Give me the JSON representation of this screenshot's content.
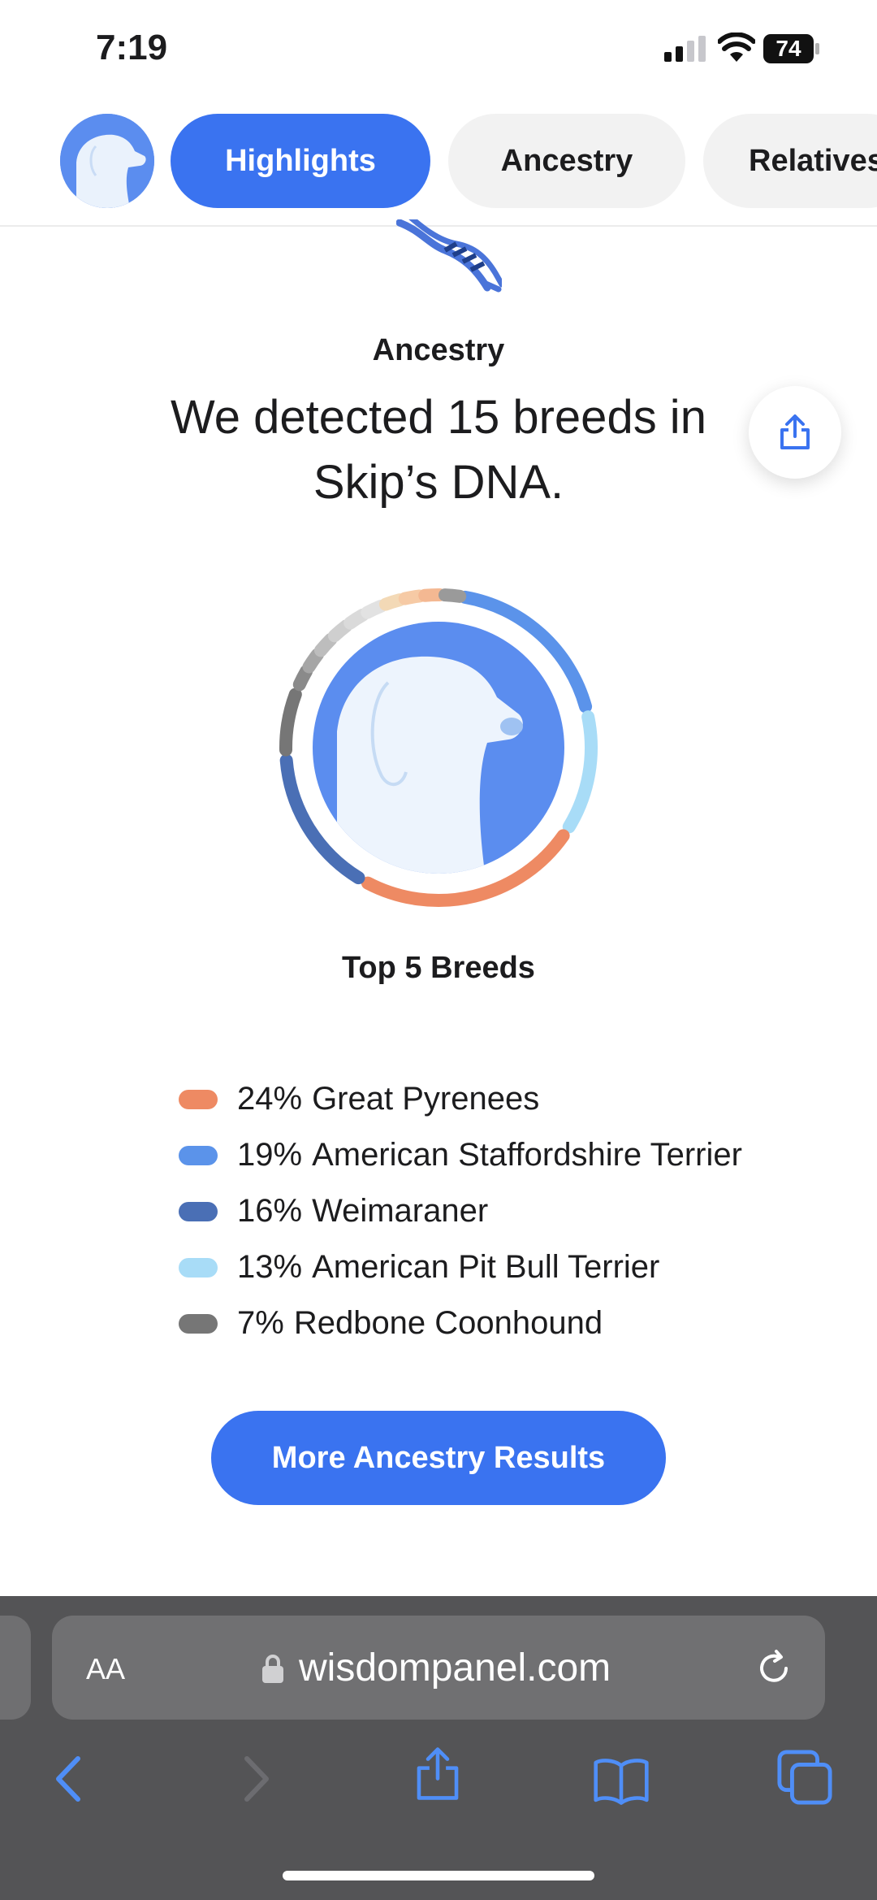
{
  "status_bar": {
    "time": "7:19",
    "battery": "74"
  },
  "tabs": [
    {
      "label": "Highlights",
      "active": true
    },
    {
      "label": "Ancestry",
      "active": false
    },
    {
      "label": "Relatives",
      "active": false
    }
  ],
  "hero": {
    "section_label": "Ancestry",
    "headline": "We detected 15 breeds in Skip’s DNA."
  },
  "chart_data": {
    "type": "pie",
    "title": "Top 5 Breeds",
    "breed_count": 15,
    "series": [
      {
        "name": "Great Pyrenees",
        "value": 24,
        "color": "#ee8a63"
      },
      {
        "name": "American Staffordshire Terrier",
        "value": 19,
        "color": "#5b93ea"
      },
      {
        "name": "Weimaraner",
        "value": 16,
        "color": "#4a6fb5"
      },
      {
        "name": "American Pit Bull Terrier",
        "value": 13,
        "color": "#a8dcf7"
      },
      {
        "name": "Redbone Coonhound",
        "value": 7,
        "color": "#767676"
      }
    ]
  },
  "legend": [
    {
      "pct": "24%",
      "name": "Great Pyrenees",
      "color": "#ee8a63"
    },
    {
      "pct": "19%",
      "name": "American Staffordshire Terrier",
      "color": "#5b93ea"
    },
    {
      "pct": "16%",
      "name": "Weimaraner",
      "color": "#4a6fb5"
    },
    {
      "pct": "13%",
      "name": "American Pit Bull Terrier",
      "color": "#a8dcf7"
    },
    {
      "pct": "7%",
      "name": "Redbone Coonhound",
      "color": "#767676"
    }
  ],
  "cta": {
    "label": "More Ancestry Results"
  },
  "browser": {
    "text_size_label": "AA",
    "url": "wisdompanel.com"
  },
  "colors": {
    "accent": "#3a73f0",
    "toolbar_bg": "#545456",
    "toolbar_icon": "#4f8ef7"
  },
  "icons": [
    "dog-avatar-icon",
    "dna-icon",
    "share-icon",
    "lock-icon",
    "reload-icon",
    "back-icon",
    "forward-icon",
    "bookmarks-icon",
    "tabs-icon"
  ]
}
